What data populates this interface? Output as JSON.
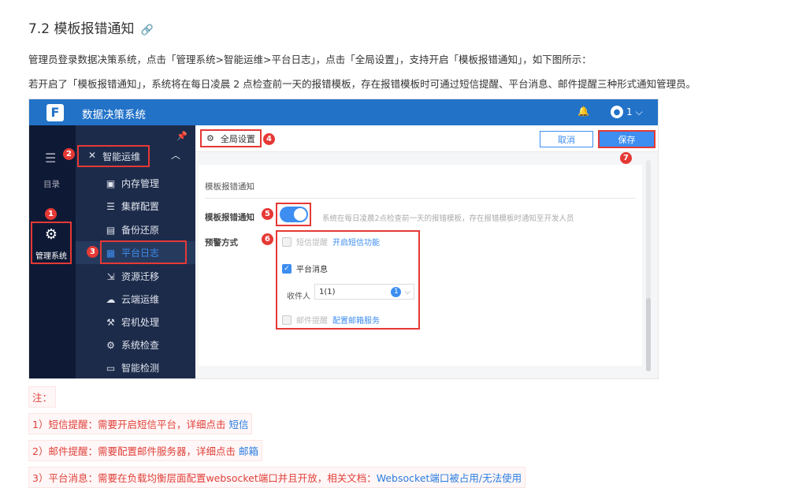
{
  "doc": {
    "title": "7.2 模板报错通知",
    "para1": "管理员登录数据决策系统，点击「管理系统>智能运维>平台日志」，点击「全局设置」，支持开启「模板报错通知」，如下图所示：",
    "para2": "若开启了「模板报错通知」，系统将在每日凌晨 2 点检查前一天的报错模板，存在报错模板时可通过短信提醒、平台消息、邮件提醒三种形式通知管理员。"
  },
  "app": {
    "title": "数据决策系统",
    "user": "1",
    "nav1": {
      "catalog": "目录",
      "admin": "管理系统"
    },
    "nav2": {
      "group": "智能运维",
      "items": [
        "内存管理",
        "集群配置",
        "备份还原",
        "平台日志",
        "资源迁移",
        "云端运维",
        "宕机处理",
        "系统检查",
        "智能检测"
      ],
      "active_index": 3
    },
    "toolbar": {
      "global_settings": "全局设置",
      "cancel": "取消",
      "save": "保存"
    },
    "panel": {
      "section_title": "模板报错通知",
      "toggle_label": "模板报错通知",
      "toggle_on": true,
      "toggle_desc": "系统在每日凌晨2点检查前一天的报错模板，存在报错模板时通知至开发人员",
      "warn_label": "预警方式",
      "sms": {
        "label": "短信提醒",
        "link": "开启短信功能",
        "checked": false
      },
      "platform": {
        "label": "平台消息",
        "checked": true
      },
      "recipient_label": "收件人",
      "recipient_value": "1(1)",
      "recipient_count": "1",
      "mail": {
        "label": "邮件提醒",
        "link": "配置邮箱服务",
        "checked": false
      }
    },
    "badges": [
      "1",
      "2",
      "3",
      "4",
      "5",
      "6",
      "7"
    ]
  },
  "notes": {
    "title": "注：",
    "n1": "1）短信提醒：需要开启短信平台，详细点击 ",
    "n1_link": "短信",
    "n2": "2）邮件提醒：需要配置邮件服务器，详细点击 ",
    "n2_link": "邮箱",
    "n3": "3）平台消息：需要在负载均衡层面配置websocket端口并且开放，相关文档：",
    "n3_link": "Websocket端口被占用/无法使用"
  },
  "colors": {
    "brand": "#2272c8",
    "accent": "#2a7de1",
    "annot": "#e53935"
  }
}
